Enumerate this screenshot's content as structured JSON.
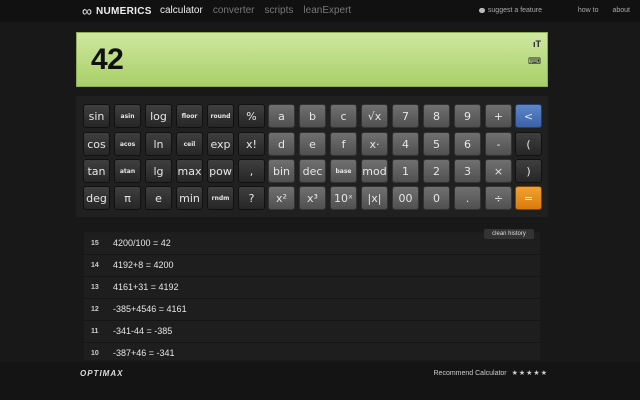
{
  "header": {
    "brand": "NUMERICS",
    "nav": [
      "calculator",
      "converter",
      "scripts",
      "leanExpert"
    ],
    "active_nav": "calculator",
    "suggest": "suggest a feature",
    "howto": "how to",
    "about": "about"
  },
  "display": {
    "value": "42"
  },
  "keys": [
    [
      "sin",
      "asin",
      "log",
      "floor",
      "round",
      "%",
      "a",
      "b",
      "c",
      "√x",
      "7",
      "8",
      "9",
      "+",
      "<"
    ],
    [
      "cos",
      "acos",
      "ln",
      "ceil",
      "exp",
      "x!",
      "d",
      "e",
      "f",
      "x·",
      "4",
      "5",
      "6",
      "-",
      "("
    ],
    [
      "tan",
      "atan",
      "lg",
      "max",
      "pow",
      ",",
      "bin",
      "dec",
      "base",
      "mod",
      "1",
      "2",
      "3",
      "×",
      ")"
    ],
    [
      "deg",
      "π",
      "e",
      "min",
      "rndm",
      "?",
      "x²",
      "x³",
      "10ˣ",
      "|x|",
      "00",
      "0",
      ".",
      "÷",
      "="
    ]
  ],
  "history": {
    "clear_label": "clean history",
    "rows": [
      {
        "n": "15",
        "expr": "4200/100 = 42"
      },
      {
        "n": "14",
        "expr": "4192+8 = 4200"
      },
      {
        "n": "13",
        "expr": "4161+31 = 4192"
      },
      {
        "n": "12",
        "expr": "-385+4546 = 4161"
      },
      {
        "n": "11",
        "expr": "-341-44 = -385"
      },
      {
        "n": "10",
        "expr": "-387+46 = -341"
      }
    ]
  },
  "footer": {
    "logo": "OPTIMAX",
    "recommend": "Recommend Calculator",
    "stars": "★★★★★"
  }
}
